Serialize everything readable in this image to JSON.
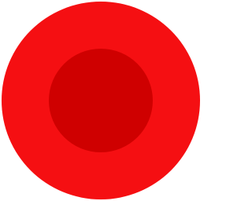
{
  "icon": {
    "name": "record-icon",
    "outer_color": "#f50f12",
    "inner_color": "#cf0000"
  }
}
